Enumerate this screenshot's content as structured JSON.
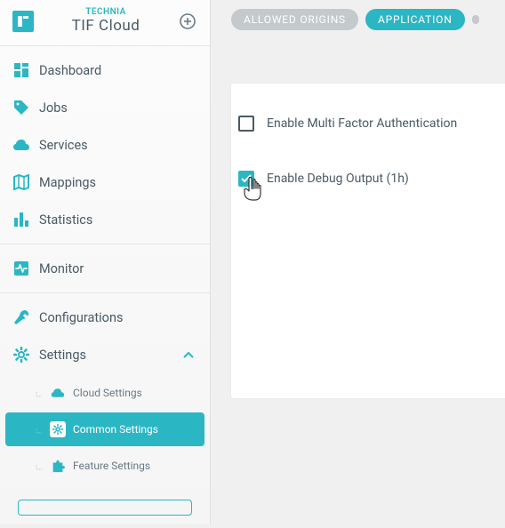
{
  "brand": {
    "top": "TECHNIA",
    "bottom": "TIF Cloud"
  },
  "sidebar": {
    "section1": [
      {
        "label": "Dashboard"
      },
      {
        "label": "Jobs"
      },
      {
        "label": "Services"
      },
      {
        "label": "Mappings"
      },
      {
        "label": "Statistics"
      }
    ],
    "section2": [
      {
        "label": "Monitor"
      }
    ],
    "section3": [
      {
        "label": "Configurations"
      },
      {
        "label": "Settings"
      }
    ],
    "settings_children": [
      {
        "label": "Cloud Settings"
      },
      {
        "label": "Common Settings"
      },
      {
        "label": "Feature Settings"
      }
    ]
  },
  "tabs": {
    "allowed_origins": "ALLOWED ORIGINS",
    "application": "APPLICATION"
  },
  "options": {
    "mfa": "Enable Multi Factor Authentication",
    "debug": "Enable Debug Output (1h)"
  },
  "colors": {
    "accent": "#2bb6c4"
  }
}
